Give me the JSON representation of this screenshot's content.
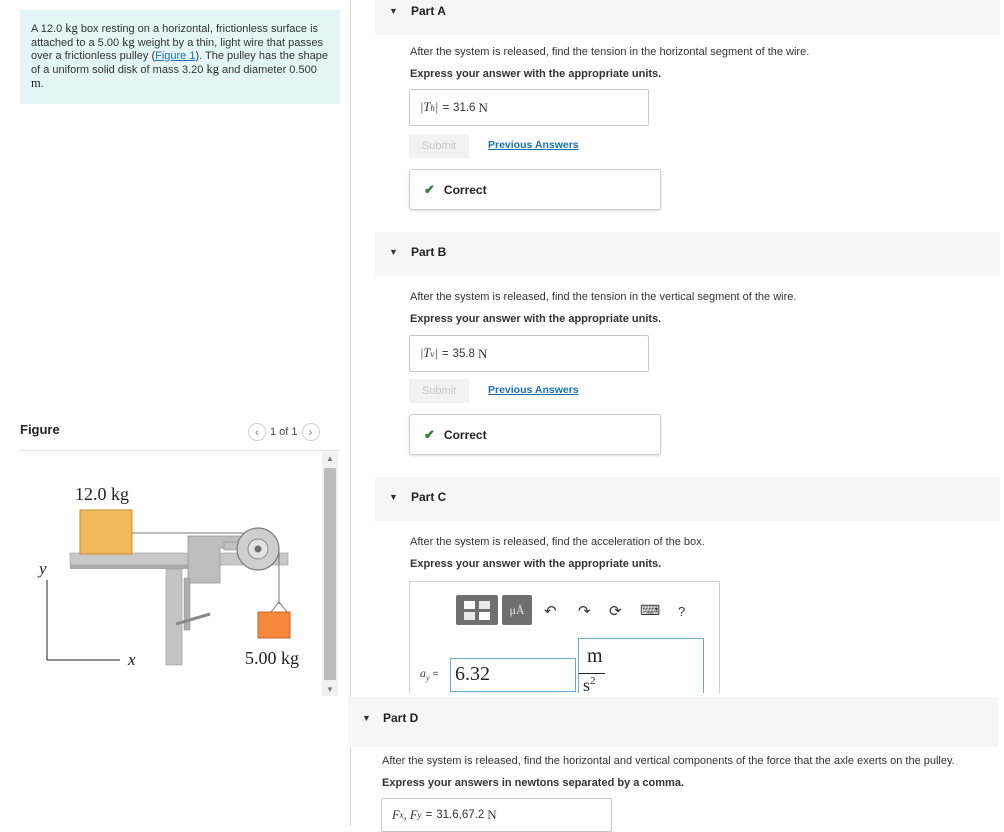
{
  "problem": {
    "text_1": "A 12.0 ",
    "kg_1": "kg",
    "text_2": " box resting on a horizontal, frictionless surface is attached to a 5.00 ",
    "kg_2": "kg",
    "text_3": " weight by a thin, light wire that passes over a frictionless pulley (",
    "figure_link": "Figure 1",
    "text_4": "). The pulley has the shape of a uniform solid disk of mass 3.20 ",
    "kg_3": "kg",
    "text_5": " and diameter 0.500 ",
    "m_unit": "m",
    "text_6": "."
  },
  "figure": {
    "title": "Figure",
    "pager": "1 of 1",
    "box_label": "12.0 kg",
    "weight_label": "5.00 kg",
    "y_axis": "y",
    "x_axis": "x",
    "box_color": "#f0b95a",
    "weight_color": "#f5883a"
  },
  "parts": {
    "a": {
      "label": "Part A",
      "question": "After the system is released, find the tension in the horizontal segment of the wire.",
      "instruction": "Express your answer with the appropriate units.",
      "var": "|T",
      "var_sub": "h",
      "var_end": "|",
      "eq": "=",
      "value": "31.6",
      "unit": "N",
      "submit": "Submit",
      "previous": "Previous Answers",
      "status": "Correct"
    },
    "b": {
      "label": "Part B",
      "question": "After the system is released, find the tension in the vertical segment of the wire.",
      "instruction": "Express your answer with the appropriate units.",
      "var": "|T",
      "var_sub": "v",
      "var_end": "|",
      "eq": "=",
      "value": "35.8",
      "unit": "N",
      "submit": "Submit",
      "previous": "Previous Answers",
      "status": "Correct"
    },
    "c": {
      "label": "Part C",
      "question": "After the system is released, find the acceleration of the box.",
      "instruction": "Express your answer with the appropriate units.",
      "var": "a",
      "var_sub": "y",
      "eq": "=",
      "value": "6.32",
      "unit_num": "m",
      "unit_den": "s",
      "unit_exp": "2",
      "units_button": "μÅ",
      "help": "?"
    },
    "d": {
      "label": "Part D",
      "question": "After the system is released, find the horizontal and vertical components of the force that the axle exerts on the pulley.",
      "instruction": "Express your answers in newtons separated by a comma.",
      "var": "F",
      "var_sub_1": "x",
      "var_mid": ", F",
      "var_sub_2": "y",
      "eq": "=",
      "value": "31.6,67.2",
      "unit": "N"
    }
  },
  "accent": "#1a6fb3",
  "correct_color": "#2e7d32"
}
